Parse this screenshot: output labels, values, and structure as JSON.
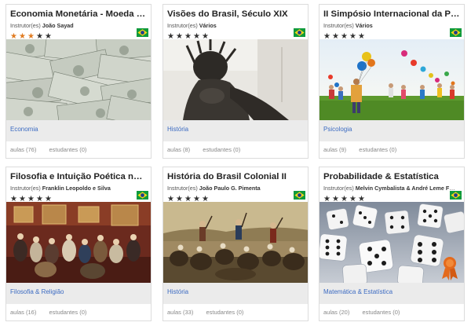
{
  "courses": [
    {
      "title": "Economia Monetária - Moeda e Bancos",
      "instructor_prefix": "Instrutor(es)",
      "instructor": "João Sayad",
      "rating": 3,
      "image": "money-stacks-image",
      "category": "Economia",
      "lessons": "aulas (76)",
      "students": "estudantes (0)"
    },
    {
      "title": "Visões do Brasil, Século XIX",
      "instructor_prefix": "Instrutor(es)",
      "instructor": "Vários",
      "rating": 0,
      "image": "bronze-statue-image",
      "category": "História",
      "lessons": "aulas (8)",
      "students": "estudantes (0)"
    },
    {
      "title": "II Simpósio Internacional da Primeira Infância",
      "instructor_prefix": "Instrutor(es)",
      "instructor": "Vários",
      "rating": 0,
      "image": "children-balloons-image",
      "category": "Psicologia",
      "lessons": "aulas (9)",
      "students": "estudantes (0)"
    },
    {
      "title": "Filosofia e Intuição Poética na Modernidade",
      "instructor_prefix": "Instrutor(es)",
      "instructor": "Franklin Leopoldo e Silva",
      "rating": 0,
      "image": "salon-painting-image",
      "category": "Filosofia & Religião",
      "lessons": "aulas (16)",
      "students": "estudantes (0)"
    },
    {
      "title": "História do Brasil Colonial II",
      "instructor_prefix": "Instrutor(es)",
      "instructor": "João Paulo G. Pimenta",
      "rating": 0,
      "image": "independence-painting-image",
      "category": "História",
      "lessons": "aulas (33)",
      "students": "estudantes (0)"
    },
    {
      "title": "Probabilidade & Estatística",
      "instructor_prefix": "Instrutor(es)",
      "instructor": "Melvin Cymbalista & André Leme Fleury",
      "rating": 0,
      "image": "dice-image",
      "category": "Matemática & Estatística",
      "lessons": "aulas (20)",
      "students": "estudantes (0)"
    }
  ],
  "flag_icon": "brazil-flag-icon",
  "star_icon": "star-icon",
  "colors": {
    "star_filled": "#e07b20",
    "star_empty": "#333333",
    "category_link": "#3c6bc2",
    "category_bar": "#ebebeb",
    "card_border": "#dcdcdc"
  }
}
